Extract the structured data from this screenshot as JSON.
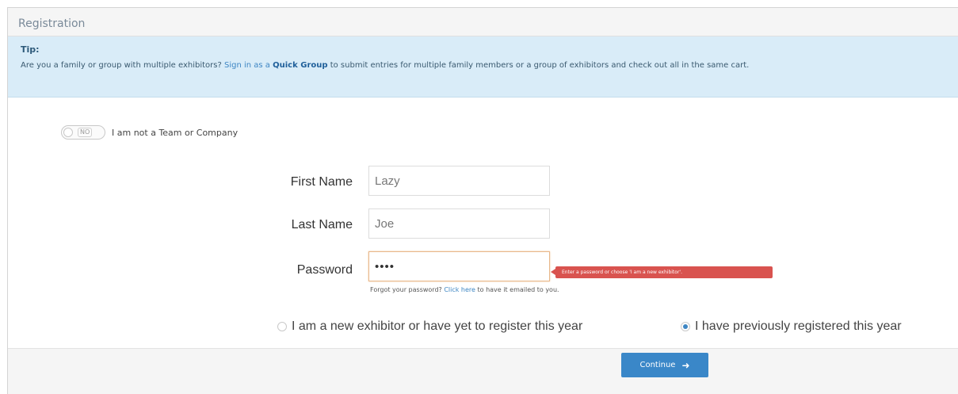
{
  "panel": {
    "title": "Registration"
  },
  "tip": {
    "title": "Tip:",
    "text_before": "Are you a family or group with multiple exhibitors? ",
    "link_sign_in": "Sign in as a",
    "space": " ",
    "link_quick_group": "Quick Group",
    "text_after": " to submit entries for multiple family members or a group of exhibitors and check out all in the same cart."
  },
  "team_toggle": {
    "state": "NO",
    "label": "I am not a Team or Company"
  },
  "form": {
    "first_name": {
      "label": "First Name",
      "value": "Lazy"
    },
    "last_name": {
      "label": "Last Name",
      "value": "Joe"
    },
    "password": {
      "label": "Password",
      "value": "••••",
      "error": "Enter a password or choose 'I am a new exhibitor'."
    },
    "forgot": {
      "text_before": "Forgot your password? ",
      "link": "Click here",
      "text_after": " to have it emailed to you."
    }
  },
  "exhibitor_options": [
    {
      "label": "I am a new exhibitor or have yet to register this year",
      "checked": false
    },
    {
      "label": "I have previously registered this year",
      "checked": true
    }
  ],
  "footer": {
    "continue_label": "Continue",
    "continue_icon": "arrow-right-icon"
  },
  "colors": {
    "primary": "#3a87c8",
    "error": "#d9534f",
    "tip_bg": "#d9ecf8"
  }
}
